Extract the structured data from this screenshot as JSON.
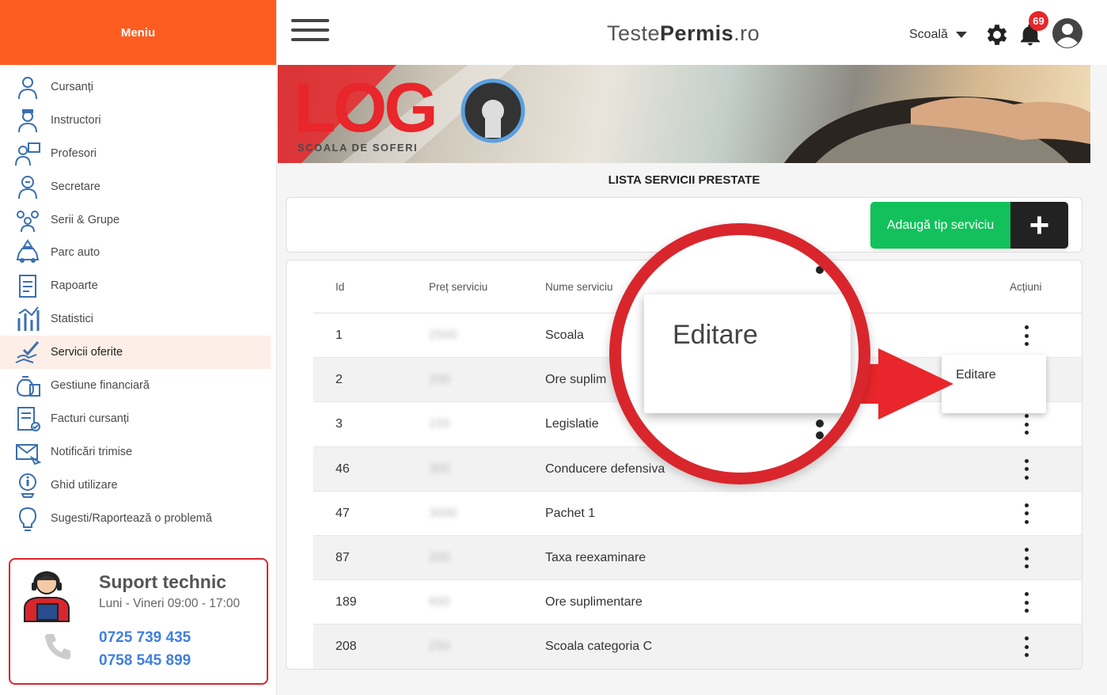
{
  "sidebar": {
    "header": "Meniu",
    "items": [
      {
        "label": "Cursanți",
        "icon": "student-icon"
      },
      {
        "label": "Instructori",
        "icon": "instructor-icon"
      },
      {
        "label": "Profesori",
        "icon": "teacher-icon"
      },
      {
        "label": "Secretare",
        "icon": "secretary-icon"
      },
      {
        "label": "Serii & Grupe",
        "icon": "groups-icon"
      },
      {
        "label": "Parc auto",
        "icon": "car-icon"
      },
      {
        "label": "Rapoarte",
        "icon": "report-icon"
      },
      {
        "label": "Statistici",
        "icon": "stats-icon"
      },
      {
        "label": "Servicii oferite",
        "icon": "services-icon",
        "active": true
      },
      {
        "label": "Gestiune financiară",
        "icon": "finance-icon"
      },
      {
        "label": "Facturi cursanți",
        "icon": "invoice-icon"
      },
      {
        "label": "Notificări trimise",
        "icon": "notification-icon"
      },
      {
        "label": "Ghid utilizare",
        "icon": "guide-icon"
      },
      {
        "label": "Sugesti/Raportează o problemă",
        "icon": "bulb-icon"
      }
    ],
    "support": {
      "title": "Suport technic",
      "hours": "Luni - Vineri 09:00 - 17:00",
      "phone1": "0725 739 435",
      "phone2": "0758 545 899"
    }
  },
  "topbar": {
    "brand_light": "Teste",
    "brand_bold": "Permis",
    "brand_suffix": ".ro",
    "school_select": "Scoală",
    "notification_count": "69"
  },
  "banner": {
    "logo_text": "LOG",
    "logo_sub": "SCOALA DE SOFERI"
  },
  "page": {
    "title": "LISTA SERVICII PRESTATE",
    "add_button": "Adaugă tip serviciu",
    "add_plus": "+"
  },
  "table": {
    "headers": {
      "id": "Id",
      "price": "Preț serviciu",
      "name": "Nume serviciu",
      "actions": "Acțiuni"
    },
    "rows": [
      {
        "id": "1",
        "price": "2500",
        "name": "Scoala"
      },
      {
        "id": "2",
        "price": "200",
        "name": "Ore suplim"
      },
      {
        "id": "3",
        "price": "150",
        "name": "Legislatie"
      },
      {
        "id": "46",
        "price": "300",
        "name": "Conducere defensiva"
      },
      {
        "id": "47",
        "price": "3000",
        "name": "Pachet 1"
      },
      {
        "id": "87",
        "price": "200",
        "name": "Taxa reexaminare"
      },
      {
        "id": "189",
        "price": "600",
        "name": "Ore suplimentare"
      },
      {
        "id": "208",
        "price": "250",
        "name": "Scoala categoria C"
      }
    ]
  },
  "dropdown": {
    "item": "Editare"
  },
  "zoom": {
    "item": "Editare"
  },
  "colors": {
    "accent": "#fd5d21",
    "green": "#12c15c",
    "red": "#d9262d",
    "link": "#3f7fe0"
  }
}
